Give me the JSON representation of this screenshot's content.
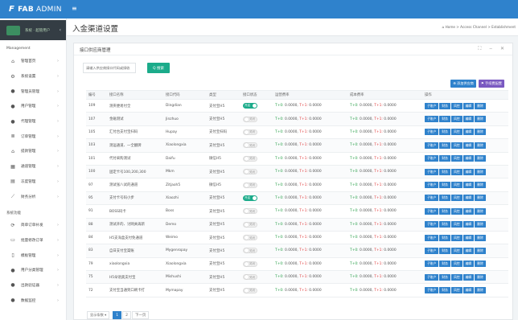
{
  "brand": {
    "logo": "F",
    "name": "FAB",
    "suffix": "ADMIN"
  },
  "topbar": {
    "menu_icon": "hamburger-icon",
    "menu_glyph": "≡"
  },
  "user_panel": {
    "name": "系统 · 超管用户"
  },
  "sidebar": {
    "section1": "Management",
    "items1": [
      {
        "label": "管理首页",
        "icon": "home-icon",
        "glyph": "⌂"
      },
      {
        "label": "系统设置",
        "icon": "gears-icon",
        "glyph": "⚙"
      },
      {
        "label": "管理员管理",
        "icon": "user-circle-icon",
        "glyph": "●"
      },
      {
        "label": "用户管理",
        "icon": "user-icon",
        "glyph": "●"
      },
      {
        "label": "代理管理",
        "icon": "user-tie-icon",
        "glyph": "●"
      },
      {
        "label": "订单管理",
        "icon": "list-icon",
        "glyph": "≣"
      },
      {
        "label": "提款管理",
        "icon": "bank-icon",
        "glyph": "⌂"
      },
      {
        "label": "通道管理",
        "icon": "grid-icon",
        "glyph": "▦"
      },
      {
        "label": "冻度管理",
        "icon": "columns-icon",
        "glyph": "▤"
      },
      {
        "label": "财务分析",
        "icon": "chart-line-icon",
        "glyph": "⟋"
      }
    ],
    "section2": "系统功能",
    "items2": [
      {
        "label": "简单订单补发",
        "icon": "refresh-icon",
        "glyph": "⟳"
      },
      {
        "label": "批量修改订单",
        "icon": "stack-icon",
        "glyph": "▭"
      },
      {
        "label": "模板管理",
        "icon": "mobile-icon",
        "glyph": "▯"
      },
      {
        "label": "用户分类管理",
        "icon": "chat-icon",
        "glyph": "●"
      },
      {
        "label": "出款验证器",
        "icon": "shield-icon",
        "glyph": "●"
      },
      {
        "label": "数据监控",
        "icon": "monitor-icon",
        "glyph": "●"
      }
    ]
  },
  "page": {
    "title": "入金渠道设置",
    "breadcrumb": "⌂ Home  >  Access Channel  >  Establishment"
  },
  "panel": {
    "title": "接口供应商管理",
    "tools": "⛶ ‒ ✕",
    "search_placeholder": "请输入供应商接口代码或接收",
    "search_label": "Q 搜索",
    "add_label": "⊕ 添加供应商",
    "fee_label": "⚑ 手续费配置"
  },
  "table": {
    "headers": [
      "编号",
      "接口名称",
      "接口代码",
      "类型",
      "接口状态",
      "运营费率",
      "成本费率",
      "操作"
    ],
    "rows": [
      {
        "id": "109",
        "name": "测夹便易付全",
        "code": "Dingdian",
        "type": "支付宝H5",
        "on": true,
        "rate": "0.0000",
        "cost": "0.0000"
      },
      {
        "id": "107",
        "name": "金磁测试",
        "code": "Jinzhuo",
        "type": "支付宝H5",
        "on": false,
        "rate": "0.0000",
        "cost": "0.0000"
      },
      {
        "id": "105",
        "name": "汇付台支付宝扫码",
        "code": "Hupay",
        "type": "支付宝扫码",
        "on": false,
        "rate": "0.0000",
        "cost": "0.0000"
      },
      {
        "id": "103",
        "name": "测运通道、一全翻牌",
        "code": "Xiaolongxia",
        "type": "支付宝H5",
        "on": false,
        "rate": "0.0000",
        "cost": "0.0000"
      },
      {
        "id": "101",
        "name": "代付采购测试",
        "code": "Daifu",
        "type": "微信H5",
        "on": false,
        "rate": "0.0000",
        "cost": "0.0000"
      },
      {
        "id": "100",
        "name": "固定卡号100,200,300",
        "code": "Mkm",
        "type": "支付宝H5",
        "on": false,
        "rate": "0.0000",
        "cost": "0.0000"
      },
      {
        "id": "97",
        "name": "测试张八试的通道",
        "code": "Zitjaoh5",
        "type": "微信H5",
        "on": false,
        "rate": "0.0000",
        "cost": "0.0000"
      },
      {
        "id": "95",
        "name": "支付卡号码小步",
        "code": "Xiaozhi",
        "type": "支付宝H5",
        "on": true,
        "rate": "0.0000",
        "cost": "0.0000"
      },
      {
        "id": "91",
        "name": "BOSS码卡",
        "code": "Boss",
        "type": "支付宝H5",
        "on": false,
        "rate": "0.0000",
        "cost": "0.0000"
      },
      {
        "id": "88",
        "name": "测试开的、讨网关再新",
        "code": "Demo",
        "type": "支付宝H5",
        "on": false,
        "rate": "0.0000",
        "cost": "0.0000"
      },
      {
        "id": "84",
        "name": "H5支海盒支付免通道",
        "code": "Weimo",
        "type": "支付宝H5",
        "on": false,
        "rate": "0.0000",
        "cost": "0.0000"
      },
      {
        "id": "83",
        "name": "自日支付宝渠账",
        "code": "Mygenropay",
        "type": "支付宝H5",
        "on": false,
        "rate": "0.0000",
        "cost": "0.0000"
      },
      {
        "id": "79",
        "name": "xiaolongxia",
        "code": "Xiaolongxia",
        "type": "支付宝H5",
        "on": false,
        "rate": "0.0000",
        "cost": "0.0000"
      },
      {
        "id": "75",
        "name": "H5朵语奥支付宝",
        "code": "Mishushi",
        "type": "支付宝H5",
        "on": false,
        "rate": "0.0000",
        "cost": "0.0000"
      },
      {
        "id": "72",
        "name": "支付宝当通到口刷卡打",
        "code": "Mymapay",
        "type": "支付宝H5",
        "on": false,
        "rate": "0.0000",
        "cost": "0.0000"
      }
    ],
    "toggle_on": "开启",
    "toggle_off": "关闭",
    "t0_label": "T+0:",
    "t1_label": "T+1:",
    "ops": [
      "子账户",
      "财务",
      "风控",
      "编辑",
      "删除"
    ]
  },
  "pager": {
    "size_label": "显示条数 ▾",
    "pages": [
      "1",
      "2"
    ],
    "next": "下一页"
  },
  "colors": {
    "primary": "#2f82cc",
    "success": "#1bab8a",
    "danger": "#e04040",
    "sidebar_dark": "#343d44"
  }
}
